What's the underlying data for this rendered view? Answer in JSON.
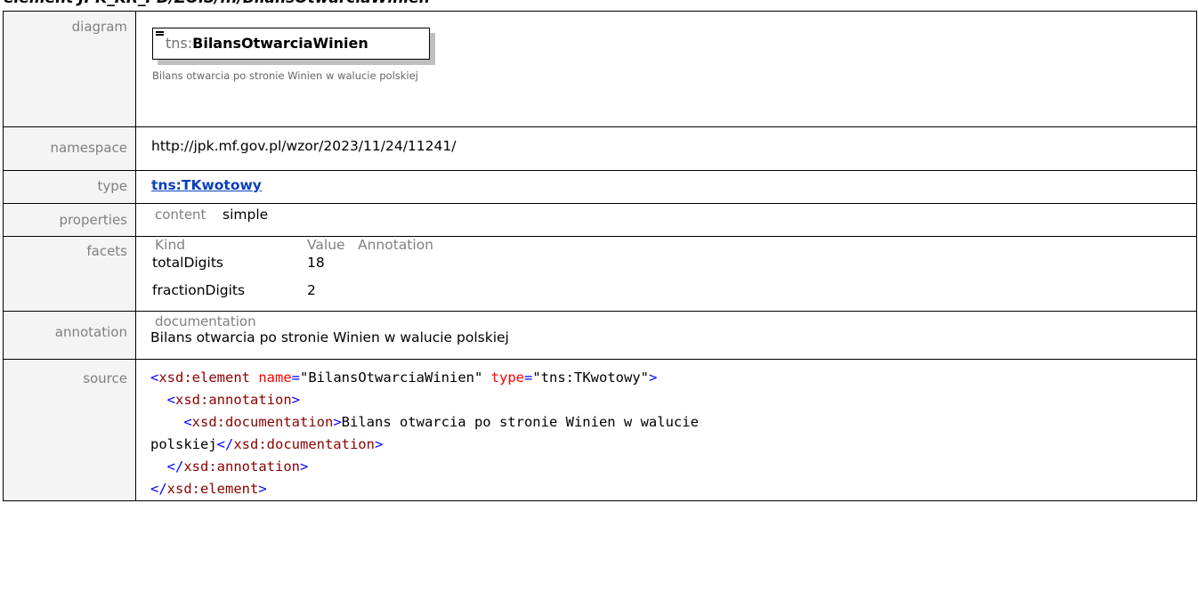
{
  "header": {
    "title": "element JPK_KR_PD/ZOiS/.../BilansOtwarciaWinien"
  },
  "labels": {
    "diagram": "diagram",
    "namespace": "namespace",
    "type": "type",
    "properties": "properties",
    "facets": "facets",
    "annotation": "annotation",
    "source": "source"
  },
  "diagram": {
    "prefix": "tns:",
    "name": "BilansOtwarciaWinien",
    "documentation": "Bilans otwarcia po stronie Winien w walucie polskiej"
  },
  "namespace": "http://jpk.mf.gov.pl/wzor/2023/11/24/11241/",
  "type": "tns:TKwotowy",
  "properties": {
    "key": "content",
    "value": "simple"
  },
  "facets": {
    "headers": [
      "Kind",
      "Value",
      "Annotation"
    ],
    "rows": [
      {
        "kind": "totalDigits",
        "value": "18",
        "annotation": ""
      },
      {
        "kind": "fractionDigits",
        "value": "2",
        "annotation": ""
      }
    ]
  },
  "annotation": {
    "heading": "documentation",
    "text": "Bilans otwarcia po stronie Winien w walucie polskiej"
  },
  "source": {
    "l1_open": "<",
    "l1_tag": "xsd:element",
    "l1_attr1": "name",
    "l1_val1": "\"BilansOtwarciaWinien\"",
    "l1_attr2": "type",
    "l1_val2": "\"tns:TKwotowy\"",
    "l1_close": ">",
    "l2_tag": "xsd:annotation",
    "l3_tag": "xsd:documentation",
    "l3_text": "Bilans otwarcia po stronie Winien w walucie",
    "l4_text": "polskiej",
    "l4_tag": "xsd:documentation",
    "l5_tag": "xsd:annotation",
    "l6_tag": "xsd:element"
  },
  "colors": {
    "tag": "#0000ff",
    "name": "#8b0000",
    "attr": "#ff0000",
    "label_bg": "#f4f4f4",
    "link": "#0b3fbd"
  }
}
